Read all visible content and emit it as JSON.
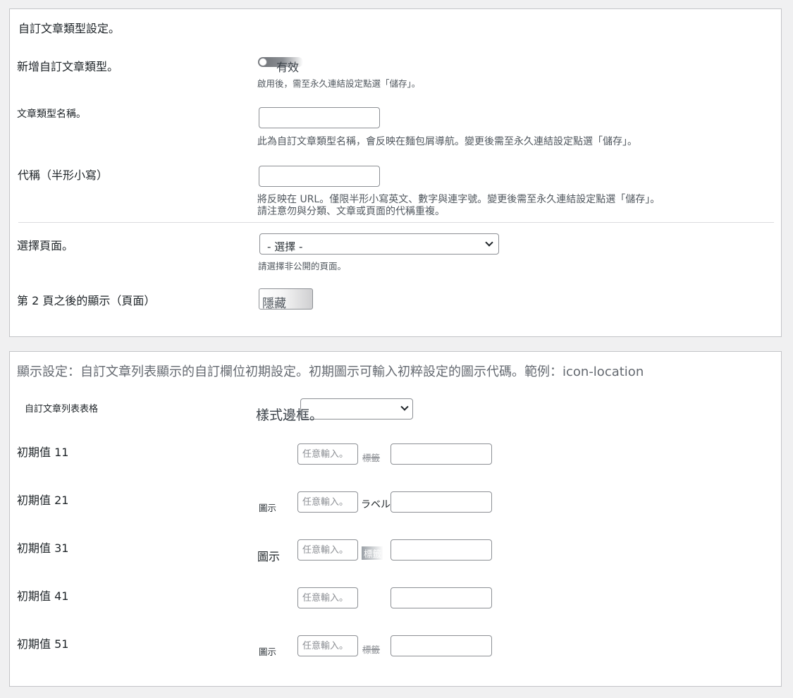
{
  "section1": {
    "title": "自訂文章類型設定。",
    "add_post_type": {
      "label": "新增自訂文章類型。",
      "toggle_label": "有效",
      "description": "啟用後，需至永久連結設定點選「儲存」。"
    },
    "post_type_name": {
      "label": "文章類型名稱。",
      "value": "",
      "description": "此為自訂文章類型名稱，會反映在麵包屑導航。變更後需至永久連結設定點選「儲存」。"
    },
    "slug": {
      "label": "代稱（半形小寫）",
      "value": "",
      "description_1": "將反映在 URL。僅限半形小寫英文、數字與連字號。變更後需至永久連結設定點選「儲存」。",
      "description_2": "請注意勿與分類、文章或頁面的代稱重複。"
    },
    "select_page": {
      "label": "選擇頁面。",
      "selected": "- 選擇 -",
      "description": "請選擇非公開的頁面。"
    },
    "page2_display": {
      "label": "第 2 頁之後的顯示（頁面）",
      "button_label": "隱藏"
    }
  },
  "section2": {
    "title": "顯示設定：自訂文章列表顯示的自訂欄位初期設定。初期圖示可輸入初粹設定的圖示代碼。範例：icon-location",
    "table_label": "自訂文章列表表格",
    "style_label": "樣式邊框。",
    "style_selected": "",
    "placeholder": "任意輸入。",
    "rows": [
      {
        "label": "初期值 11",
        "icon_label": "",
        "field_label": "標籤"
      },
      {
        "label": "初期值 21",
        "icon_label": "圖示",
        "field_label": "ラベル"
      },
      {
        "label": "初期值 31",
        "icon_label": "圖示",
        "field_label": "標籤"
      },
      {
        "label": "初期值 41",
        "icon_label": "",
        "field_label": ""
      },
      {
        "label": "初期值 51",
        "icon_label": "圖示",
        "field_label": "標籤"
      }
    ]
  },
  "colors": {
    "background": "#f0f0f1",
    "panel_border": "#c3c4c7",
    "input_border": "#8c8f94",
    "muted_text": "#646970"
  }
}
